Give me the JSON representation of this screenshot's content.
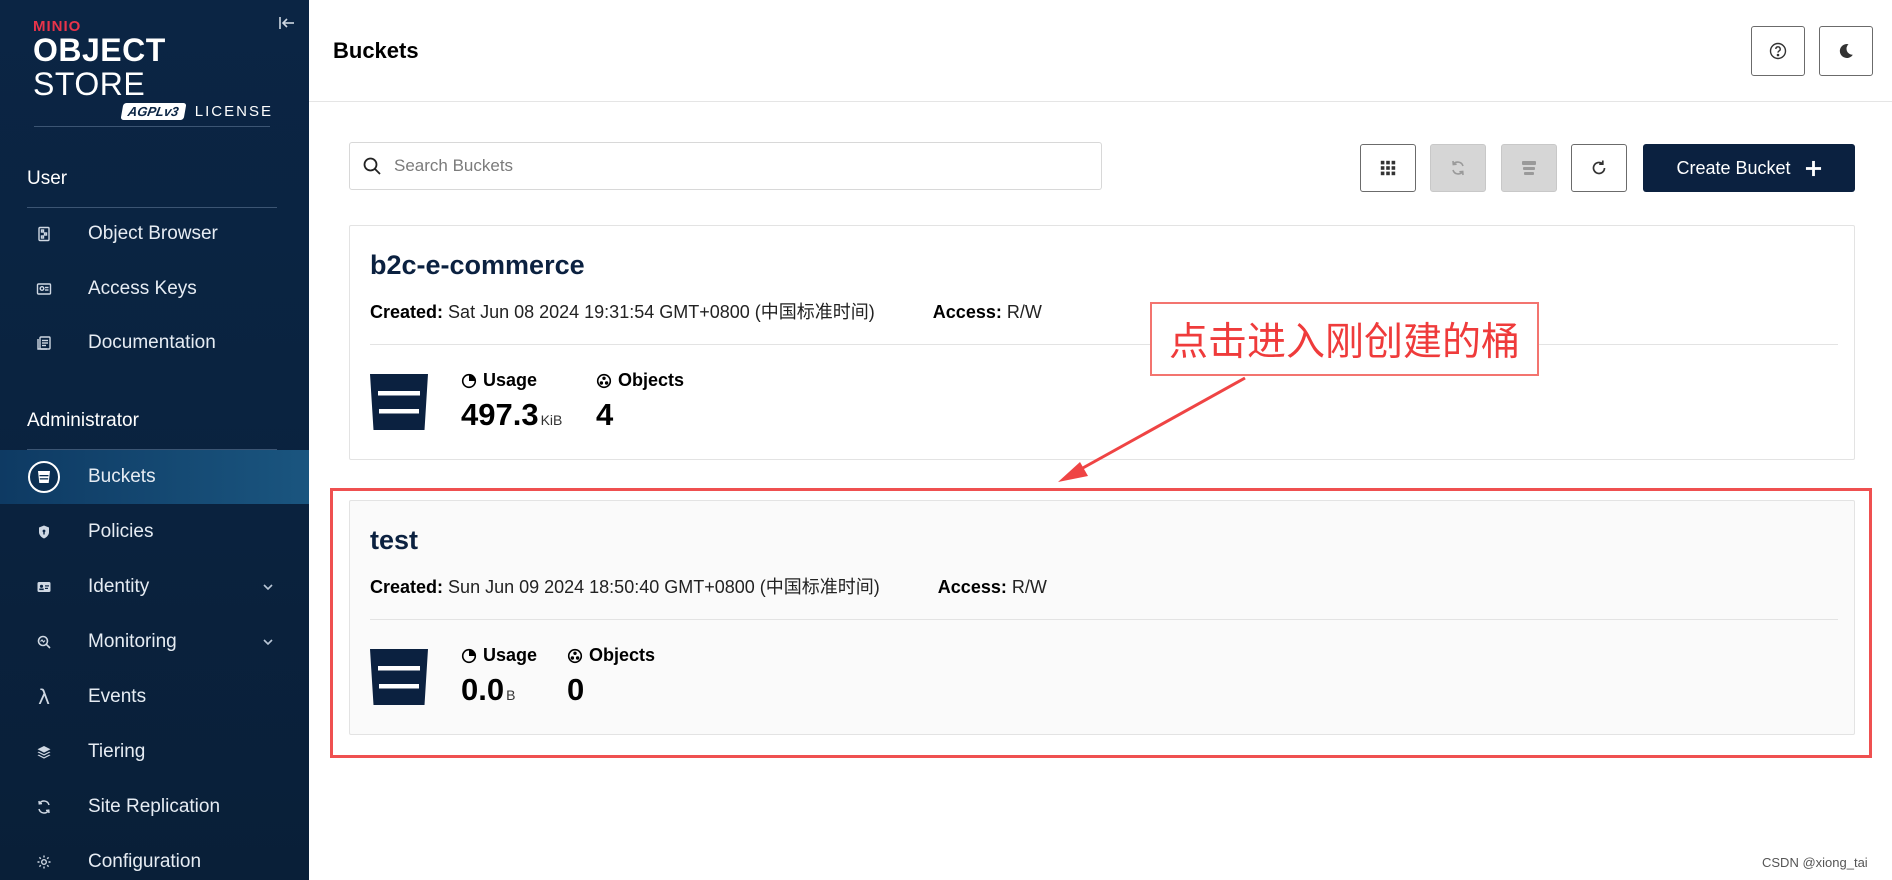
{
  "sidebar": {
    "logo": {
      "brand": "MINIO",
      "title_bold": "OBJECT",
      "title_thin": "STORE",
      "badge": "AGPLv3",
      "license": "LICENSE"
    },
    "sections": [
      {
        "title": "User",
        "items": [
          {
            "label": "Object Browser",
            "icon": "object-browser-icon"
          },
          {
            "label": "Access Keys",
            "icon": "access-keys-icon"
          },
          {
            "label": "Documentation",
            "icon": "documentation-icon"
          }
        ]
      },
      {
        "title": "Administrator",
        "items": [
          {
            "label": "Buckets",
            "icon": "bucket-icon",
            "active": true
          },
          {
            "label": "Policies",
            "icon": "shield-icon"
          },
          {
            "label": "Identity",
            "icon": "identity-icon",
            "expandable": true
          },
          {
            "label": "Monitoring",
            "icon": "monitoring-icon",
            "expandable": true
          },
          {
            "label": "Events",
            "icon": "lambda-icon"
          },
          {
            "label": "Tiering",
            "icon": "layers-icon"
          },
          {
            "label": "Site Replication",
            "icon": "replication-icon"
          },
          {
            "label": "Configuration",
            "icon": "gear-icon"
          }
        ]
      }
    ]
  },
  "header": {
    "title": "Buckets"
  },
  "toolbar": {
    "search_placeholder": "Search Buckets",
    "create_label": "Create Bucket"
  },
  "buckets": [
    {
      "name": "b2c-e-commerce",
      "created_label": "Created:",
      "created": "Sat Jun 08 2024 19:31:54 GMT+0800 (中国标准时间)",
      "access_label": "Access:",
      "access": "R/W",
      "usage_label": "Usage",
      "usage_value": "497.3",
      "usage_unit": "KiB",
      "objects_label": "Objects",
      "objects_value": "4"
    },
    {
      "name": "test",
      "created_label": "Created:",
      "created": "Sun Jun 09 2024 18:50:40 GMT+0800 (中国标准时间)",
      "access_label": "Access:",
      "access": "R/W",
      "usage_label": "Usage",
      "usage_value": "0.0",
      "usage_unit": "B",
      "objects_label": "Objects",
      "objects_value": "0"
    }
  ],
  "annotation": {
    "text": "点击进入刚创建的桶",
    "color": "#ef3b3b"
  },
  "watermark": "CSDN @xiong_tai",
  "colors": {
    "sidebar_bg": "#0b2544",
    "accent_dark": "#0b2140",
    "annotation": "#ef5050"
  }
}
